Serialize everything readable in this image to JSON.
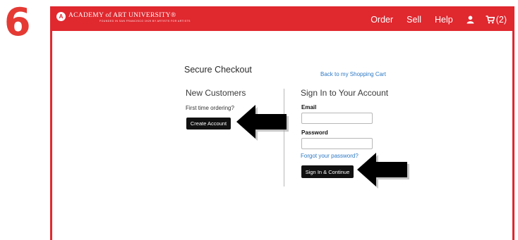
{
  "step_number": "6",
  "header": {
    "logo_mark": "A",
    "logo_name": "ACADEMY of ART UNIVERSITY®",
    "logo_tagline": "FOUNDED IN SAN FRANCISCO 1929 BY ARTISTS FOR ARTISTS",
    "nav": {
      "order": "Order",
      "sell": "Sell",
      "help": "Help",
      "cart_count": "(2)"
    },
    "icons": [
      "user-icon",
      "cart-icon"
    ],
    "bar_color": "#e0282f"
  },
  "checkout": {
    "heading": "Secure Checkout",
    "back_link": "Back to my Shopping Cart",
    "new_customers": {
      "title": "New Customers",
      "subtitle": "First time ordering?",
      "create_button": "Create Account"
    },
    "sign_in": {
      "title": "Sign In to Your Account",
      "email_label": "Email",
      "email_value": "",
      "password_label": "Password",
      "password_value": "",
      "forgot_link": "Forgot your password?",
      "submit_button": "Sign In & Continue"
    }
  },
  "colors": {
    "accent": "#e0282f",
    "step_number": "#e53a34",
    "link": "#2d78c4",
    "button": "#111111"
  },
  "annotations": [
    "arrow-to-create-account",
    "arrow-to-sign-in-button"
  ]
}
